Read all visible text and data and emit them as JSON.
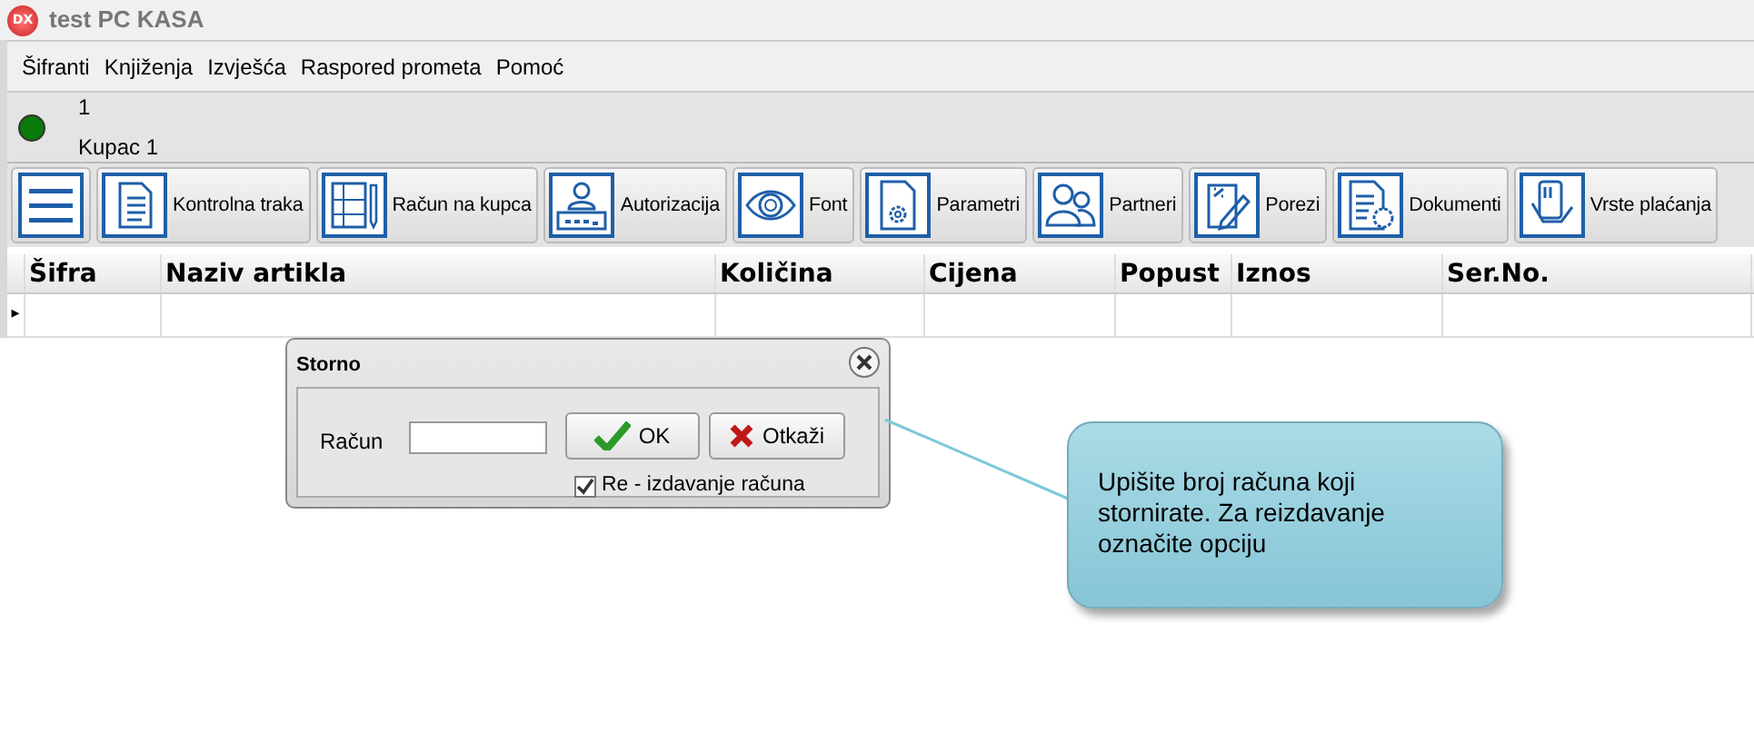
{
  "window": {
    "title": "test PC KASA",
    "logo": "DX"
  },
  "menu": [
    "Šifranti",
    "Knjiženja",
    "Izvješća",
    "Raspored prometa",
    "Pomoć"
  ],
  "status": {
    "online": true,
    "line_1": "1",
    "line_2": "Kupac 1"
  },
  "toolbar": [
    {
      "kind": "icon"
    },
    {
      "kind": "labeled",
      "label": "Kontrolna traka"
    },
    {
      "kind": "labeled",
      "label": "Račun na kupca"
    },
    {
      "kind": "labeled",
      "label": "Autorizacija"
    },
    {
      "kind": "labeled",
      "label": "Font"
    },
    {
      "kind": "labeled",
      "label": "Parametri"
    },
    {
      "kind": "labeled",
      "label": "Partneri"
    },
    {
      "kind": "labeled",
      "label": "Porezi"
    },
    {
      "kind": "labeled",
      "label": "Dokumenti"
    },
    {
      "kind": "labeled",
      "label": "Vrste plaćanja"
    }
  ],
  "table": {
    "columns": [
      "Šifra",
      "Naziv artikla",
      "Količina",
      "Cijena",
      "Popust",
      "Iznos",
      "Ser.No."
    ],
    "current_row_marker": "▸"
  },
  "dialog": {
    "title": "Storno",
    "field_label": "Račun",
    "ok": "OK",
    "cancel": "Otkaži",
    "reissue": {
      "label": "Re - izdavanje računa",
      "checked": true
    }
  },
  "callout": "Upišite broj računa koji stornirate. Za reizdavanje označite opciju"
}
